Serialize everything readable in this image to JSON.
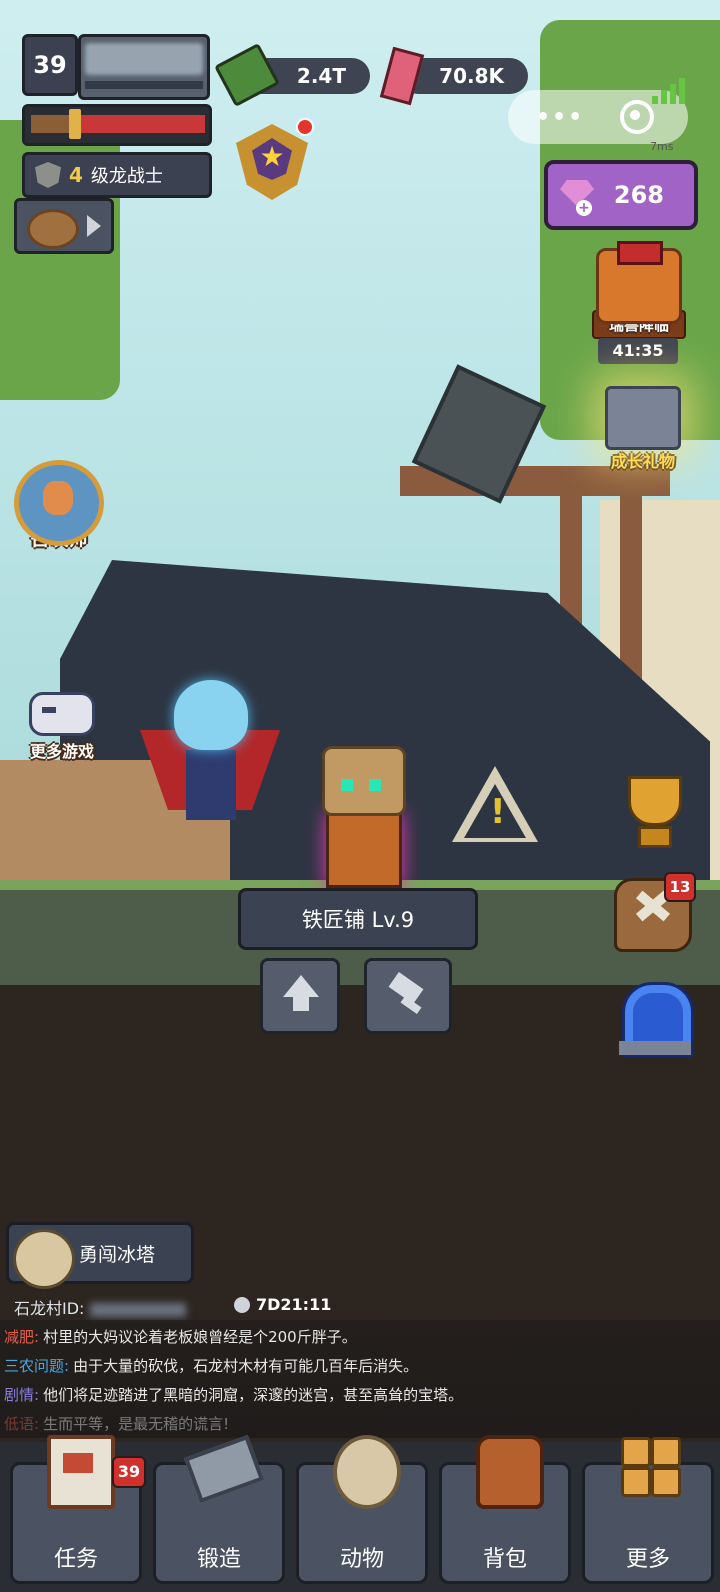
{
  "player": {
    "level": "39",
    "rank_number": "4",
    "rank_title": "级龙战士"
  },
  "currency": {
    "cash": "2.4T",
    "crystals": "70.8K",
    "gems": "268"
  },
  "miniprogram": {
    "ping": "7ms"
  },
  "events": {
    "beast_label": "瑞兽降临",
    "beast_timer": "41:35",
    "growth_gift_label": "成长礼物",
    "summoner_label": "召唤师",
    "more_games_label": "更多游戏"
  },
  "building": {
    "name": "铁匠铺 Lv.9"
  },
  "forge_badge": "13",
  "quest": {
    "label": "勇闯冰塔"
  },
  "village": {
    "id_label": "石龙村ID:",
    "countdown": "7D21:11"
  },
  "news": [
    {
      "tag": "减肥:",
      "tag_color": "#e0604a",
      "text": "村里的大妈议论着老板娘曾经是个200斤胖子。"
    },
    {
      "tag": "三农问题:",
      "tag_color": "#4aa8e0",
      "text": "由于大量的砍伐，石龙村木材有可能几百年后消失。"
    },
    {
      "tag": "剧情:",
      "tag_color": "#8b7fe0",
      "text": "他们将足迹踏进了黑暗的洞窟，深邃的迷宫，甚至高耸的宝塔。"
    },
    {
      "tag": "低语:",
      "tag_color": "#e0604a",
      "text": "生而平等，是最无稽的谎言!"
    }
  ],
  "nav": {
    "task": "任务",
    "task_badge": "39",
    "forge": "锻造",
    "animal": "动物",
    "bag": "背包",
    "more": "更多"
  }
}
